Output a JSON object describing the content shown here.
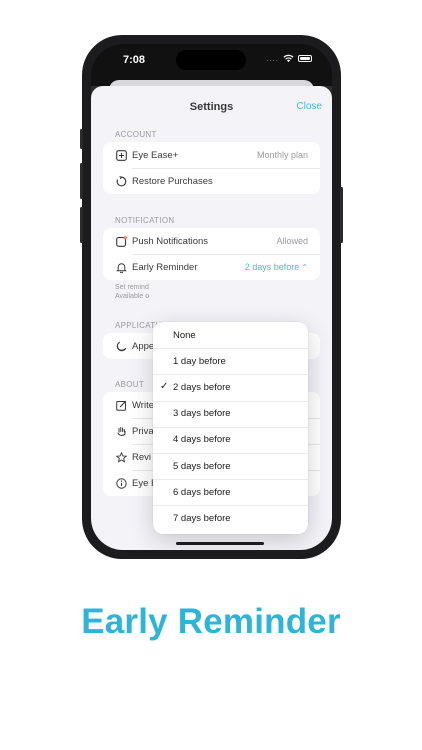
{
  "status_bar": {
    "time": "7:08",
    "carrier_dots": "...."
  },
  "nav": {
    "title": "Settings",
    "close": "Close"
  },
  "account": {
    "header": "ACCOUNT",
    "rows": [
      {
        "label": "Eye Ease+",
        "value": "Monthly plan",
        "icon": "plus-square-icon"
      },
      {
        "label": "Restore Purchases",
        "value": "",
        "icon": "restore-icon"
      }
    ]
  },
  "notification": {
    "header": "NOTIFICATION",
    "rows": [
      {
        "label": "Push Notifications",
        "value": "Allowed",
        "icon": "notification-badge-icon"
      },
      {
        "label": "Early Reminder",
        "value": "2 days before",
        "icon": "bell-icon"
      }
    ],
    "footnote_line1": "Set remind",
    "footnote_line2": "Available o"
  },
  "application": {
    "header": "APPLICATIO",
    "rows": [
      {
        "label": "Appe",
        "icon": "moon-icon"
      }
    ]
  },
  "about": {
    "header": "ABOUT",
    "rows": [
      {
        "label": "Write",
        "icon": "edit-icon"
      },
      {
        "label": "Priva",
        "icon": "hand-icon"
      },
      {
        "label": "Revi",
        "icon": "star-icon"
      },
      {
        "label": "Eye E",
        "icon": "info-icon"
      }
    ]
  },
  "menu": {
    "selected": "2 days before",
    "options": [
      "None",
      "1 day before",
      "2 days before",
      "3 days before",
      "4 days before",
      "5 days before",
      "6 days before",
      "7 days before"
    ]
  },
  "caption": "Early Reminder",
  "colors": {
    "accent": "#34aee0",
    "caption": "#2fb4d8",
    "background": "#f2f2f7"
  }
}
